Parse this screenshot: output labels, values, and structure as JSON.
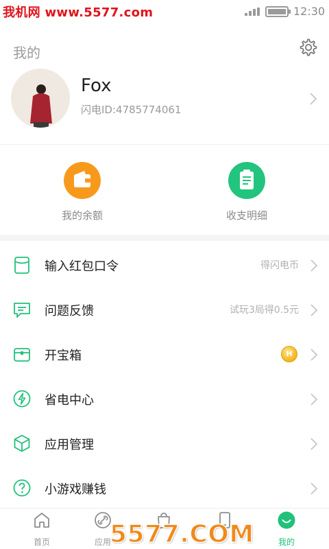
{
  "watermark_top": "我机网 www.5577.com",
  "watermark_bottom": "5577.COM",
  "status_bar": {
    "time": "12:30",
    "signal_icon": "signal-icon",
    "battery_icon": "battery-icon"
  },
  "header": {
    "title": "我的",
    "settings_icon": "gear-icon"
  },
  "profile": {
    "name": "Fox",
    "id_text": "闪电ID:4785774061"
  },
  "quick_actions": [
    {
      "label": "我的余额",
      "icon": "wallet-icon",
      "color": "#f79a1c"
    },
    {
      "label": "收支明细",
      "icon": "clipboard-icon",
      "color": "#22c47e"
    }
  ],
  "menu": [
    {
      "label": "输入红包口令",
      "right_text": "得闪电币",
      "icon": "envelope-icon"
    },
    {
      "label": "问题反馈",
      "right_text": "试玩3局得0.5元",
      "icon": "message-icon"
    },
    {
      "label": "开宝箱",
      "right_text": "",
      "icon": "chest-icon",
      "badge": "coin-badge"
    },
    {
      "label": "省电中心",
      "right_text": "",
      "icon": "lightning-icon"
    },
    {
      "label": "应用管理",
      "right_text": "",
      "icon": "cube-icon"
    },
    {
      "label": "小游戏赚钱",
      "right_text": "",
      "icon": "question-icon"
    }
  ],
  "tabs": [
    {
      "label": "首页",
      "icon": "home-icon"
    },
    {
      "label": "应用",
      "icon": "link-icon"
    },
    {
      "label": "",
      "icon": "bag-icon"
    },
    {
      "label": "",
      "icon": "phone-icon"
    },
    {
      "label": "我的",
      "icon": "smile-icon",
      "active": true
    }
  ],
  "colors": {
    "accent": "#21c17a",
    "orange": "#f79a1c",
    "watermark_red": "#e0141b"
  }
}
